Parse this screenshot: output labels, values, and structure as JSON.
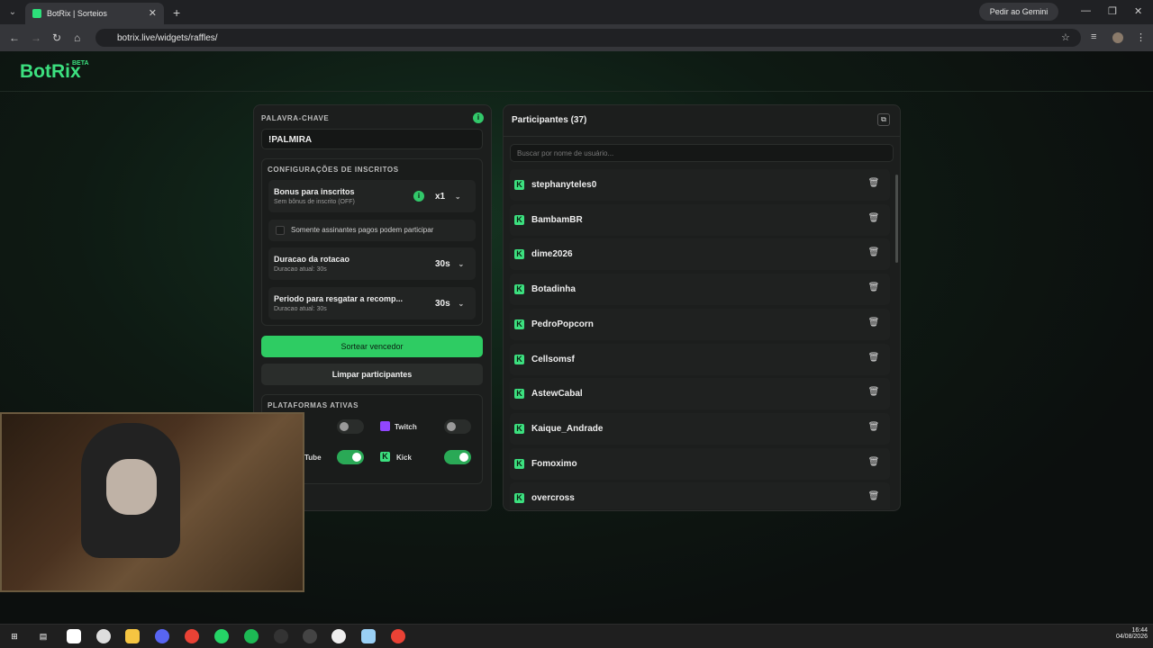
{
  "browser": {
    "tab_title": "BotRix | Sorteios",
    "gemini_label": "Pedir ao Gemini",
    "url": "botrix.live/widgets/raffles/"
  },
  "logo": {
    "text": "BotRix",
    "badge": "BETA"
  },
  "left_panel": {
    "keyword_label": "PALAVRA-CHAVE",
    "keyword_value": "!PALMIRA",
    "subs_section_label": "CONFIGURAÇÕES DE INSCRITOS",
    "bonus_title": "Bonus para inscritos",
    "bonus_sub": "Sem bônus de inscrito (OFF)",
    "bonus_value": "x1",
    "paid_only_label": "Somente assinantes pagos podem participar",
    "rotation_title": "Duracao da rotacao",
    "rotation_sub": "Duracao atual: 30s",
    "rotation_value": "30s",
    "redeem_title": "Periodo para resgatar a recomp...",
    "redeem_sub": "Duracao atual: 30s",
    "redeem_value": "30s",
    "draw_button": "Sortear vencedor",
    "clear_button": "Limpar participantes",
    "platforms_label": "PLATAFORMAS ATIVAS",
    "platforms": [
      {
        "name": "Twitch",
        "on": false
      },
      {
        "name": "Kick",
        "on": true
      },
      {
        "name": "Tube",
        "on": true
      }
    ]
  },
  "right_panel": {
    "title": "Participantes (37)",
    "search_placeholder": "Buscar por nome de usuário...",
    "participants": [
      "stephanyteles0",
      "BambamBR",
      "dime2026",
      "Botadinha",
      "PedroPopcorn",
      "Cellsomsf",
      "AstewCabal",
      "Kaique_Andrade",
      "Fomoximo",
      "overcross"
    ]
  },
  "taskbar": {
    "time": "16:44",
    "date": "04/08/2026"
  },
  "colors": {
    "accent": "#2ecc63",
    "bg": "#0d1110"
  }
}
